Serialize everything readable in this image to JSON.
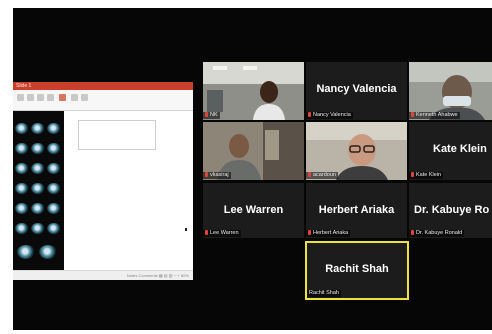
{
  "shared_screen": {
    "window_title": "Slide 1",
    "status_text": "Notes  Comments  ▦  ▤  ▥  ─  +  80%"
  },
  "participants": [
    {
      "name": "NK",
      "display": "",
      "video": true,
      "muted": true
    },
    {
      "name": "Nancy Valencia",
      "display": "Nancy Valencia",
      "video": false,
      "muted": true
    },
    {
      "name": "Kenneth Ahabwe",
      "display": "",
      "video": true,
      "muted": true
    },
    {
      "name": "vkasiraj",
      "display": "",
      "video": true,
      "muted": true
    },
    {
      "name": "acardoun",
      "display": "",
      "video": true,
      "muted": true
    },
    {
      "name": "Kate Klein",
      "display": "Kate Klein",
      "video": false,
      "muted": true
    },
    {
      "name": "Lee Warren",
      "display": "Lee Warren",
      "video": false,
      "muted": true
    },
    {
      "name": "Herbert Ariaka",
      "display": "Herbert Ariaka",
      "video": false,
      "muted": true
    },
    {
      "name": "Dr. Kabuye Ronald",
      "display": "Dr. Kabuye Ro",
      "video": false,
      "muted": true
    },
    {
      "name": "Rachit Shah",
      "display": "Rachit Shah",
      "video": false,
      "muted": false,
      "active_speaker": true
    }
  ],
  "colors": {
    "active_speaker_border": "#ece33d",
    "muted_icon": "#e0433b",
    "ppt_accent": "#c9412a"
  }
}
